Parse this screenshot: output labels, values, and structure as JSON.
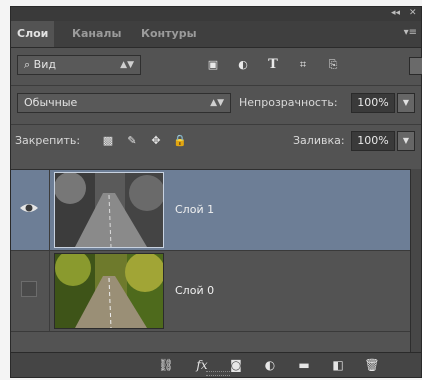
{
  "tabs": [
    "Слои",
    "Каналы",
    "Контуры"
  ],
  "filter": {
    "kind_label": "Вид"
  },
  "blend": {
    "mode_label": "Обычные",
    "opacity_label": "Непрозрачность:",
    "opacity_value": "100%"
  },
  "lock": {
    "label": "Закрепить:",
    "fill_label": "Заливка:",
    "fill_value": "100%"
  },
  "layers": [
    {
      "name": "Слой 1",
      "visible": true,
      "selected": true
    },
    {
      "name": "Слой 0",
      "visible": false,
      "selected": false
    }
  ],
  "colors": {
    "panel_bg": "#535353",
    "selected_layer": "#6d7e96",
    "tab_bar": "#3f3f3f"
  },
  "bottom_icons": [
    "link-icon",
    "fx-icon",
    "mask-icon",
    "adjustment-icon",
    "folder-icon",
    "new-layer-icon",
    "trash-icon"
  ]
}
